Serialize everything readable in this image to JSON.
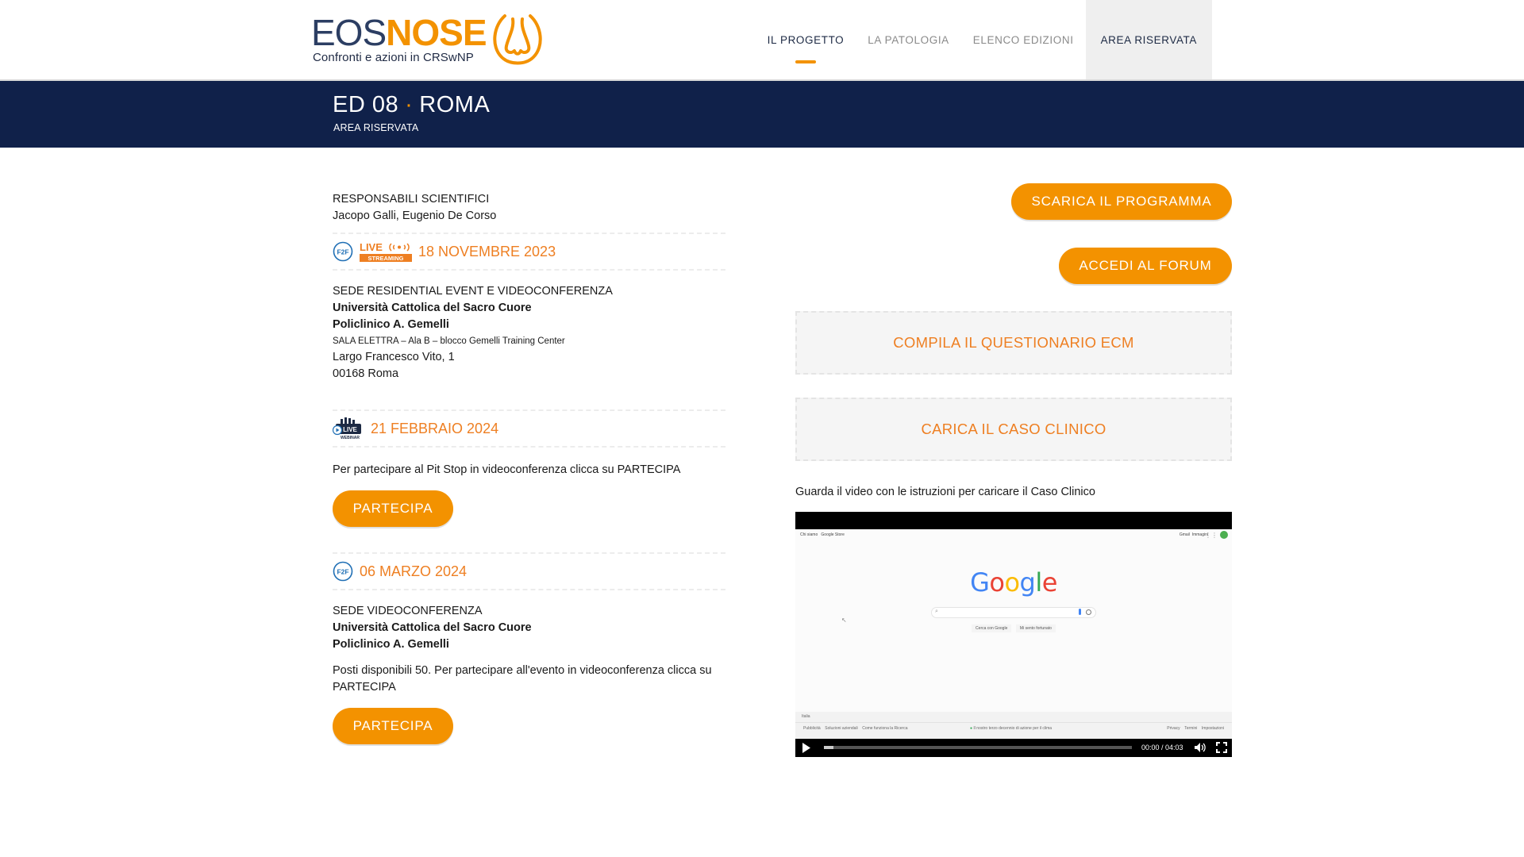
{
  "logo": {
    "part1": "EOS",
    "part2": "NOSE",
    "subtitle": "Confronti e azioni in CRSwNP"
  },
  "nav": [
    {
      "label": "IL PROGETTO",
      "active": true
    },
    {
      "label": "LA PATOLOGIA",
      "active": false
    },
    {
      "label": "ELENCO EDIZIONI",
      "active": false
    },
    {
      "label": "AREA RISERVATA",
      "active": false
    }
  ],
  "banner": {
    "edition": "ED 08",
    "city": "ROMA",
    "subtitle": "AREA RISERVATA"
  },
  "responsabili": {
    "label": "RESPONSABILI SCIENTIFICI",
    "names": "Jacopo Galli, Eugenio De Corso"
  },
  "event1": {
    "badge_f2f": "F2F",
    "badge_live": "LIVE",
    "badge_streaming": "STREAMING",
    "date": "18 NOVEMBRE 2023",
    "sede_label": "SEDE RESIDENTIAL EVENT E VIDEOCONFERENZA",
    "venue1": "Università Cattolica del Sacro Cuore",
    "venue2": "Policlinico A. Gemelli",
    "room": "SALA ELETTRA – Ala B – blocco Gemelli Training Center",
    "address1": "Largo Francesco Vito, 1",
    "address2": "00168 Roma"
  },
  "event2": {
    "badge_live": "LIVE",
    "badge_webinar": "WEBINAR",
    "date": "21 FEBBRAIO 2024",
    "text": "Per partecipare al Pit Stop in videoconferenza clicca su PARTECIPA",
    "button": "PARTECIPA"
  },
  "event3": {
    "badge_f2f": "F2F",
    "date": "06 MARZO 2024",
    "sede_label": "SEDE VIDEOCONFERENZA",
    "venue1": "Università Cattolica del Sacro Cuore",
    "venue2": "Policlinico A. Gemelli",
    "text1": "Posti disponibili 50. Per partecipare all'evento in videoconferenza clicca su",
    "text2": "PARTECIPA",
    "button": "PARTECIPA"
  },
  "actions": {
    "programma": "SCARICA IL PROGRAMMA",
    "forum": "ACCEDI AL FORUM",
    "questionario": "COMPILA IL QUESTIONARIO ECM",
    "caso": "CARICA IL CASO CLINICO"
  },
  "video": {
    "caption": "Guarda il video con le istruzioni per caricare il Caso Clinico",
    "time": "00:00 / 04:03",
    "google": {
      "logo_letters": [
        "G",
        "o",
        "o",
        "g",
        "l",
        "e"
      ],
      "logo_colors": [
        "#4285f4",
        "#ea4335",
        "#fbbc05",
        "#4285f4",
        "#34a853",
        "#ea4335"
      ],
      "top_left_1": "Chi siamo",
      "top_left_2": "Google Store",
      "top_right_1": "Gmail",
      "top_right_2": "Immagini",
      "btn_search": "Cerca con Google",
      "btn_lucky": "Mi sento fortunato",
      "country": "Italia",
      "footer_1": "Pubblicità",
      "footer_2": "Soluzioni aziendali",
      "footer_3": "Come funziona la Ricerca",
      "footer_mid": "Il nostro terzo decennio di azione per il clima",
      "footer_r1": "Privacy",
      "footer_r2": "Termini",
      "footer_r3": "Impostazioni"
    }
  },
  "colors": {
    "orange": "#f39200",
    "navy": "#10214a",
    "date_orange": "#ee7f22"
  }
}
